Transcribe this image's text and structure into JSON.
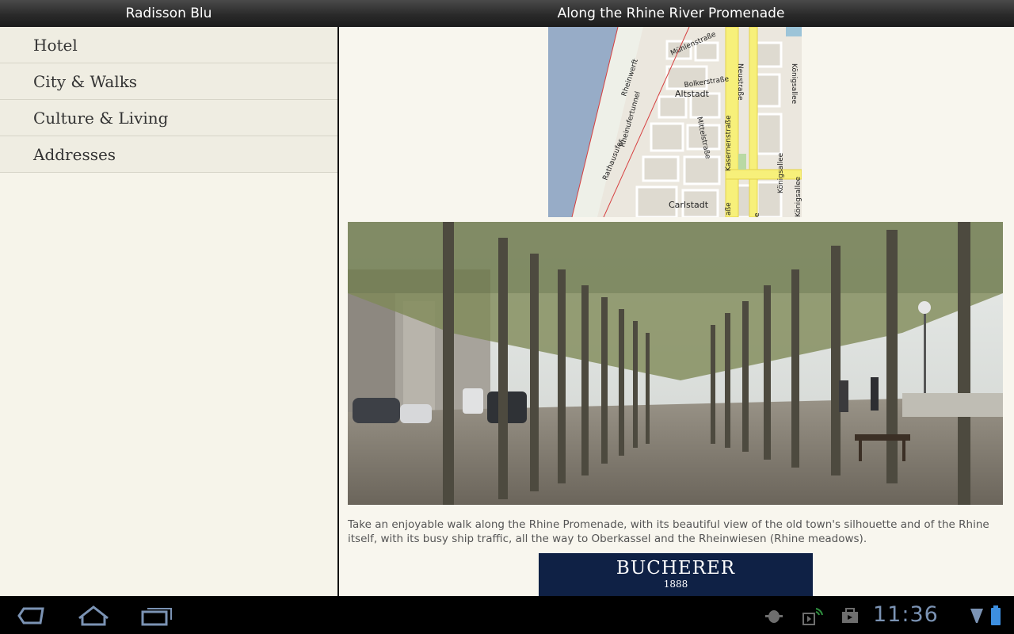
{
  "titlebar": {
    "left_title": "Radisson Blu",
    "right_title": "Along the Rhine River Promenade"
  },
  "sidebar": {
    "items": [
      {
        "label": "Hotel"
      },
      {
        "label": "City & Walks"
      },
      {
        "label": "Culture & Living"
      },
      {
        "label": "Addresses"
      }
    ]
  },
  "map": {
    "labels": {
      "muehlenstrasse": "Mühlenstraße",
      "rheinwerft": "Rheinwerft",
      "bolkerstrasse": "Bolkerstraße",
      "altstadt": "Altstadt",
      "neustrasse": "Neustraße",
      "koenigsallee_top": "Königsallee",
      "rheinufertunnel": "Rheinufertunnel",
      "mittelstrasse": "Mittelstraße",
      "kasernenstrasse": "Kasernenstraße",
      "koenigsallee_mid": "Königsallee",
      "koenigsallee_bottom": "Königsallee",
      "rathausufer": "Rathausufer",
      "carlstadt": "Carlstadt",
      "strasse_fragment": "aße",
      "e_fragment": "e"
    }
  },
  "article": {
    "caption": "Take an enjoyable walk along the Rhine Promenade, with its beautiful view of the old town's silhouette and of the Rhine itself, with its busy ship traffic, all the way to Oberkassel and the Rheinwiesen (Rhine meadows).",
    "ad_brand": "BUCHERER",
    "ad_year": "1888"
  },
  "status": {
    "clock": "11:36"
  },
  "icons": {
    "back": "back-icon",
    "home": "home-icon",
    "recent_apps": "recent-apps-icon",
    "debug": "android-debug-icon",
    "media": "media-wireless-icon",
    "store": "shopping-bag-icon",
    "signal": "signal-icon",
    "battery": "battery-icon"
  },
  "colors": {
    "system_blue": "#7b93b4",
    "ad_background": "#0f2145",
    "sidebar_background": "#f6f4ea"
  }
}
